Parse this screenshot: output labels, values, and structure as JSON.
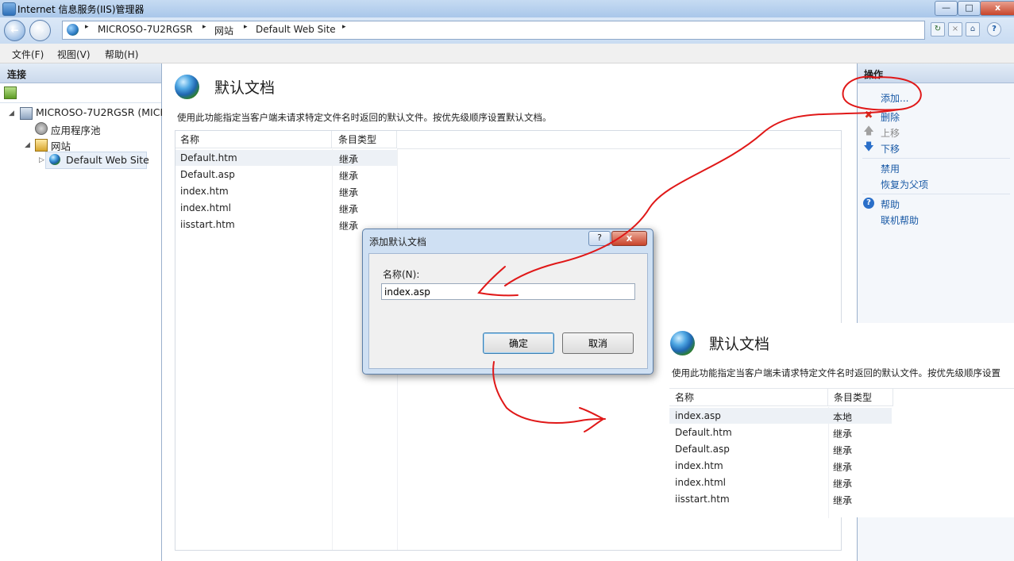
{
  "window": {
    "title": "Internet 信息服务(IIS)管理器",
    "controls": {
      "minimize": "—",
      "maximize": "□",
      "close": "x"
    }
  },
  "address": {
    "crumbs": [
      "MICROSO-7U2RGSR",
      "网站",
      "Default Web Site"
    ],
    "separator": "▸",
    "help_glyph": "?"
  },
  "menu": [
    "文件(F)",
    "视图(V)",
    "帮助(H)"
  ],
  "connections": {
    "header": "连接",
    "tree": {
      "server": "MICROSO-7U2RGSR (MICF",
      "app_pools": "应用程序池",
      "sites": "网站",
      "default_site": "Default Web Site"
    }
  },
  "main": {
    "title": "默认文档",
    "description": "使用此功能指定当客户端未请求特定文件名时返回的默认文件。按优先级顺序设置默认文档。",
    "columns": [
      "名称",
      "条目类型"
    ],
    "rows": [
      {
        "name": "Default.htm",
        "type": "继承"
      },
      {
        "name": "Default.asp",
        "type": "继承"
      },
      {
        "name": "index.htm",
        "type": "继承"
      },
      {
        "name": "index.html",
        "type": "继承"
      },
      {
        "name": "iisstart.htm",
        "type": "继承"
      }
    ]
  },
  "actions": {
    "header": "操作",
    "items": {
      "add": "添加...",
      "remove": "删除",
      "move_up": "上移",
      "move_down": "下移",
      "disable": "禁用",
      "revert": "恢复为父项",
      "help": "帮助",
      "online_help": "联机帮助"
    }
  },
  "dialog": {
    "title": "添加默认文档",
    "help_glyph": "?",
    "close_glyph": "x",
    "name_label": "名称(N):",
    "name_value": "index.asp",
    "ok": "确定",
    "cancel": "取消"
  },
  "result": {
    "title": "默认文档",
    "description": "使用此功能指定当客户端未请求特定文件名时返回的默认文件。按优先级顺序设置",
    "columns": [
      "名称",
      "条目类型"
    ],
    "rows": [
      {
        "name": "index.asp",
        "type": "本地"
      },
      {
        "name": "Default.htm",
        "type": "继承"
      },
      {
        "name": "Default.asp",
        "type": "继承"
      },
      {
        "name": "index.htm",
        "type": "继承"
      },
      {
        "name": "index.html",
        "type": "继承"
      },
      {
        "name": "iisstart.htm",
        "type": "继承"
      }
    ]
  },
  "colors": {
    "annotation": "#e01818",
    "link": "#1a5aa6",
    "panel_header": "#cbd9ec"
  }
}
